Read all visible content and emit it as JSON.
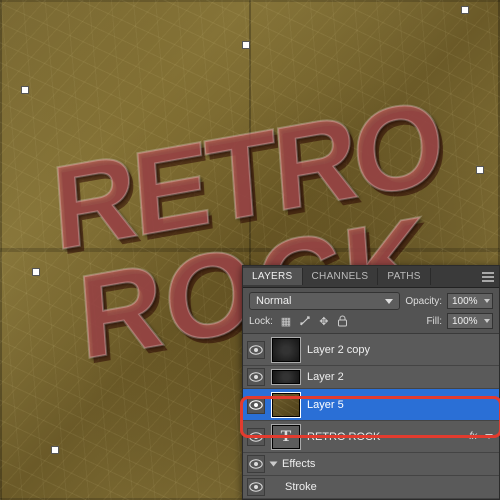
{
  "canvas": {
    "text_line1": "RETRO",
    "text_line2": "ROCK"
  },
  "panel": {
    "tabs": {
      "layers": "LAYERS",
      "channels": "CHANNELS",
      "paths": "PATHS"
    },
    "blend_mode": "Normal",
    "opacity_label": "Opacity:",
    "opacity_value": "100%",
    "lock_label": "Lock:",
    "fill_label": "Fill:",
    "fill_value": "100%",
    "layers": [
      {
        "name": "Layer 2 copy"
      },
      {
        "name": "Layer 2"
      },
      {
        "name": "Layer 5"
      },
      {
        "name": "RETRO ROCK"
      },
      {
        "name": "Effects"
      },
      {
        "name": "Stroke"
      }
    ],
    "fx_badge": "fx",
    "text_thumb_glyph": "T"
  }
}
